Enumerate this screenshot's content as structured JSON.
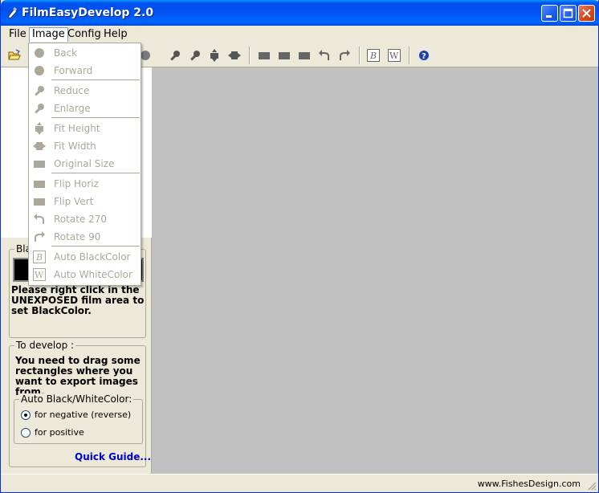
{
  "app": {
    "title": "FilmEasyDevelop 2.0"
  },
  "menubar": {
    "items": [
      {
        "label": "File",
        "key": "F"
      },
      {
        "label": "Image",
        "key": "I"
      },
      {
        "label": "Config",
        "key": "C"
      },
      {
        "label": "Help",
        "key": "H"
      }
    ]
  },
  "image_menu": {
    "items": [
      {
        "label": "Back",
        "icon": "circle-icon"
      },
      {
        "label": "Forward",
        "icon": "circle-icon"
      },
      {
        "label": "Reduce",
        "icon": "magnifier-icon"
      },
      {
        "label": "Enlarge",
        "icon": "magnifier-icon"
      },
      {
        "label": "Fit Height",
        "icon": "fit-height-icon"
      },
      {
        "label": "Fit Width",
        "icon": "fit-width-icon"
      },
      {
        "label": "Original Size",
        "icon": "rectangle-icon"
      },
      {
        "label": "Flip Horiz",
        "icon": "rectangle-icon"
      },
      {
        "label": "Flip Vert",
        "icon": "rectangle-icon"
      },
      {
        "label": "Rotate 270",
        "icon": "rotate-left-icon"
      },
      {
        "label": "Rotate 90",
        "icon": "rotate-right-icon"
      },
      {
        "label": "Auto BlackColor",
        "icon": "b-letter-icon"
      },
      {
        "label": "Auto WhiteColor",
        "icon": "w-letter-icon"
      }
    ]
  },
  "left_panel": {
    "black_group_legend": "Bla",
    "black_instructions": "Please right click in the UNEXPOSED film area to set BlackColor.",
    "develop_legend": "To develop :",
    "develop_instructions": "You need to drag some rectangles where you want to export images from.",
    "auto_legend": "Auto Black/WhiteColor:",
    "radio_negative": "for negative (reverse)",
    "radio_positive": "for positive",
    "negative_selected": true,
    "quick_guide": "Quick Guide..."
  },
  "statusbar": {
    "text": "www.FishesDesign.com"
  },
  "colors": {
    "accent": "#0053ee",
    "main_area": "#c0c0c0",
    "link": "#0000cc",
    "disabled": "#aca899"
  }
}
